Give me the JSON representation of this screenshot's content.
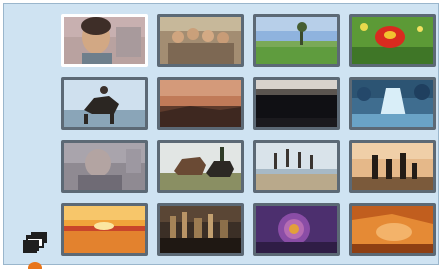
{
  "gallery": {
    "thumbnails": [
      {
        "subject": "portrait-child",
        "selected": true
      },
      {
        "subject": "group-family"
      },
      {
        "subject": "landscape-tree"
      },
      {
        "subject": "red-flower"
      },
      {
        "subject": "horse-rider"
      },
      {
        "subject": "sunset-shore"
      },
      {
        "subject": "dark-landscape"
      },
      {
        "subject": "waterfall"
      },
      {
        "subject": "portrait-faded"
      },
      {
        "subject": "horses-field"
      },
      {
        "subject": "people-jumping-beach"
      },
      {
        "subject": "family-silhouettes"
      },
      {
        "subject": "sunset-water"
      },
      {
        "subject": "city-skyline"
      },
      {
        "subject": "purple-flower"
      },
      {
        "subject": "orange-abstract"
      }
    ]
  },
  "controls": {
    "view_toggle_icon": "stacked-windows-icon"
  },
  "colors": {
    "panel_background": "#cfe3f2",
    "thumbnail_border": "#5c6975",
    "selected_border": "#ffffff",
    "indicator_dot": "#e8751a"
  }
}
